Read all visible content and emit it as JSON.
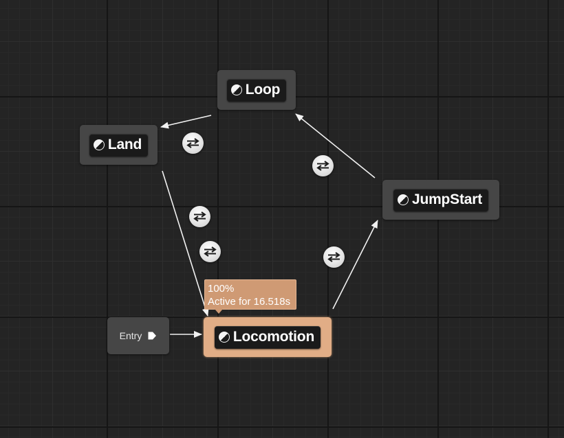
{
  "states": {
    "loop": {
      "label": "Loop"
    },
    "land": {
      "label": "Land"
    },
    "jumpstart": {
      "label": "JumpStart"
    },
    "locomotion": {
      "label": "Locomotion",
      "active": true,
      "tooltip": {
        "weight": "100%",
        "active_time": "Active for 16.518s"
      }
    }
  },
  "entry": {
    "label": "Entry"
  },
  "transitions": [
    {
      "from": "Loop",
      "to": "Land"
    },
    {
      "from": "Land",
      "to": "Locomotion"
    },
    {
      "from": "Locomotion",
      "to": "Land"
    },
    {
      "from": "Locomotion",
      "to": "JumpStart"
    },
    {
      "from": "JumpStart",
      "to": "Loop"
    }
  ],
  "colors": {
    "canvas": "#242424",
    "node": "#464646",
    "active_node": "#e1ad86",
    "wire": "#f2f2f2"
  }
}
